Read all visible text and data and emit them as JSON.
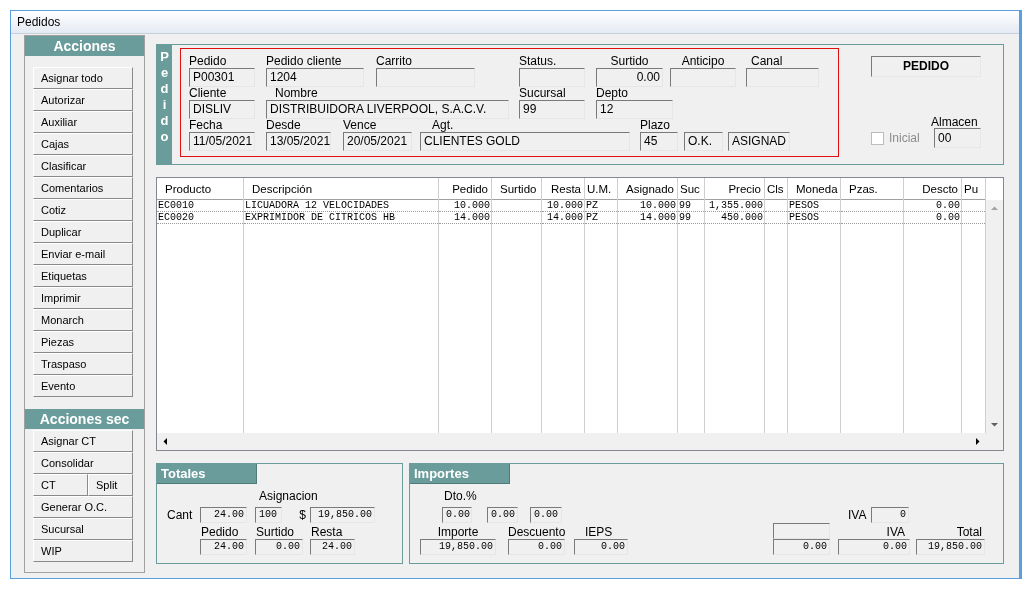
{
  "window": {
    "title": "Pedidos"
  },
  "actions": {
    "title": "Acciones",
    "buttons": [
      "Asignar todo",
      "Autorizar",
      "Auxiliar",
      "Cajas",
      "Clasificar",
      "Comentarios",
      "Cotiz",
      "Duplicar",
      "Enviar e-mail",
      "Etiquetas",
      "Imprimir",
      "Monarch",
      "Piezas",
      "Traspaso",
      "Evento"
    ]
  },
  "secondary_actions": {
    "title": "Acciones sec",
    "rows": [
      [
        "Asignar CT"
      ],
      [
        "Consolidar"
      ],
      [
        "CT",
        "Split"
      ],
      [
        "Generar O.C."
      ],
      [
        "Sucursal"
      ],
      [
        "WIP"
      ]
    ]
  },
  "order": {
    "tab": "Pedido",
    "rows": [
      [
        {
          "label": "Pedido",
          "value": "P00301"
        },
        {
          "label": "Pedido cliente",
          "value": "1204"
        },
        {
          "label": "Carrito"
        },
        {
          "label": "Status."
        },
        {
          "label": "Surtido",
          "value": "0.00"
        },
        {
          "label": "Anticipo"
        },
        {
          "label": "Canal"
        }
      ],
      [
        {
          "label": "Cliente",
          "value": "DISLIV"
        },
        {
          "label": "Nombre",
          "value": "DISTRIBUIDORA LIVERPOOL, S.A.C.V."
        },
        {
          "label": "Sucursal",
          "value": "99"
        },
        {
          "label": "Depto",
          "value": "12"
        }
      ],
      [
        {
          "label": "Fecha",
          "value": "11/05/2021"
        },
        {
          "label": "Desde",
          "value": "13/05/2021"
        },
        {
          "label": "Vence",
          "value": "20/05/2021"
        },
        {
          "label": "Agt.",
          "value": "CLIENTES GOLD"
        },
        {
          "label": "Plazo",
          "value": "45"
        },
        {
          "value": "O.K."
        },
        {
          "value": "ASIGNAD"
        }
      ]
    ]
  },
  "document_type": "PEDIDO",
  "almacen": {
    "label": "Almacen",
    "value": "00"
  },
  "inicial": {
    "label": "Inicial",
    "checked": false,
    "disabled": true
  },
  "table": {
    "columns": [
      "Producto",
      "Descripción",
      "Pedido",
      "Surtido",
      "Resta",
      "U.M.",
      "Asignado",
      "Suc",
      "Precio",
      "Cls",
      "Moneda",
      "Pzas.",
      "Descto",
      "Pu"
    ],
    "rows": [
      [
        "EC0010",
        "LICUADORA 12 VELOCIDADES",
        "10.000",
        null,
        "10.000",
        "PZ",
        "10.000",
        "99",
        "1,355.000",
        null,
        "PESOS",
        null,
        "0.00",
        null
      ],
      [
        "EC0020",
        "EXPRIMIDOR DE CITRICOS HB",
        "14.000",
        null,
        "14.000",
        "PZ",
        "14.000",
        "99",
        "450.000",
        null,
        "PESOS",
        null,
        "0.00",
        null
      ]
    ]
  },
  "totales": {
    "title": "Totales",
    "asignacion_label": "Asignacion",
    "cant": {
      "label": "Cant",
      "value": "24.00"
    },
    "asignacion_pct": "100",
    "currency": "$",
    "asignacion_amount": "19,850.00",
    "pedido": {
      "label": "Pedido",
      "value": "24.00"
    },
    "surtido": {
      "label": "Surtido",
      "value": "0.00"
    },
    "resta": {
      "label": "Resta",
      "value": "24.00"
    }
  },
  "importes": {
    "title": "Importes",
    "dto_label": "Dto.%",
    "dto": [
      "0.00",
      "0.00",
      "0.00"
    ],
    "iva_rate": {
      "label": "IVA",
      "value": "0"
    },
    "importe": {
      "label": "Importe",
      "value": "19,850.00"
    },
    "descuento": {
      "label": "Descuento",
      "value": "0.00"
    },
    "ieps": {
      "label": "IEPS",
      "value": "0.00"
    },
    "unlabeled_amount": {
      "value": "0.00"
    },
    "iva": {
      "label": "IVA",
      "value": "0.00"
    },
    "total": {
      "label": "Total",
      "value": "19,850.00"
    }
  }
}
